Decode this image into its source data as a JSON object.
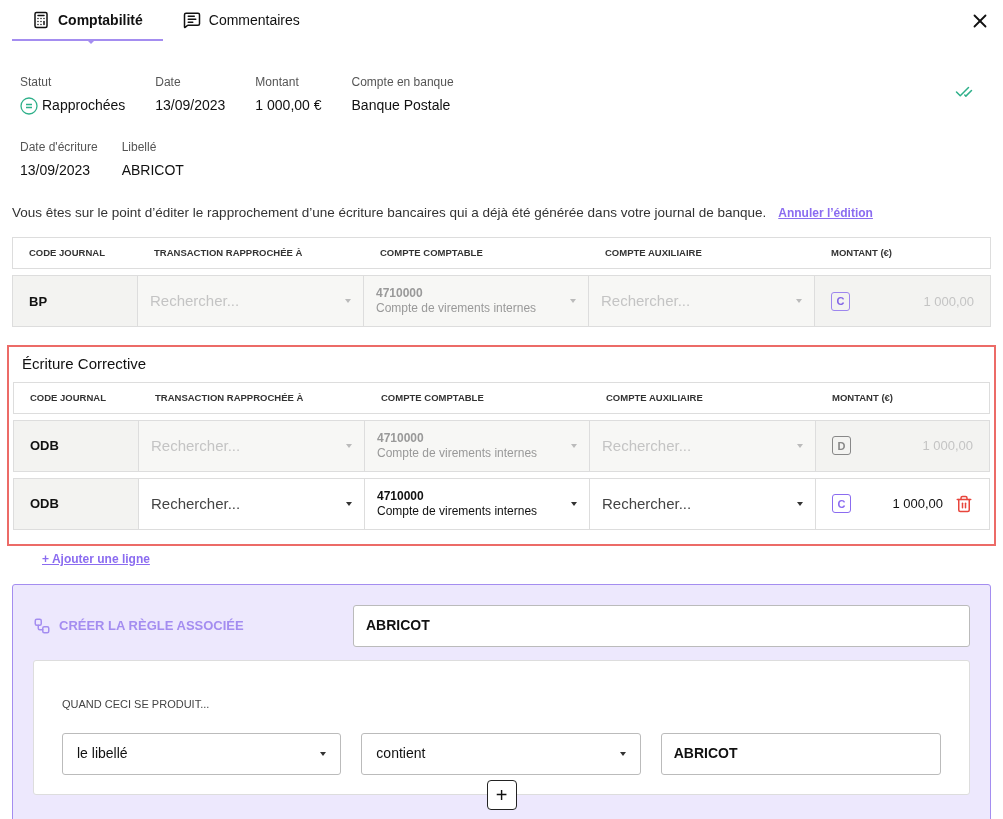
{
  "tabs": [
    {
      "label": "Comptabilité",
      "selected": true
    },
    {
      "label": "Commentaires",
      "selected": false
    }
  ],
  "summary": [
    {
      "label": "Statut",
      "value": "Rapprochées",
      "kind": "status"
    },
    {
      "label": "Date",
      "value": "13/09/2023",
      "kind": "text"
    },
    {
      "label": "Montant",
      "value": "1 000,00 €",
      "kind": "text"
    },
    {
      "label": "Compte en banque",
      "value": "Banque Postale",
      "kind": "text"
    }
  ],
  "summary2": [
    {
      "label": "Date d'écriture",
      "value": "13/09/2023"
    },
    {
      "label": "Libellé",
      "value": "ABRICOT"
    }
  ],
  "notice": {
    "text": "Vous êtes sur le point d’éditer le rapprochement d’une écriture bancaires qui a déjà été générée dans votre journal de banque.",
    "link": "Annuler l’édition"
  },
  "columns": [
    "CODE JOURNAL",
    "TRANSACTION RAPPROCHÉE À",
    "COMPTE COMPTABLE",
    "COMPTE AUXILIAIRE",
    "MONTANT (€)"
  ],
  "bank_rows": [
    {
      "journal": "BP",
      "transaction_placeholder": "Rechercher...",
      "account_number": "4710000",
      "account_name": "Compte de virements internes",
      "auxiliary_placeholder": "Rechercher...",
      "sign": "C",
      "amount": "1 000,00",
      "disabled": true
    }
  ],
  "corrective": {
    "title": "Écriture Corrective",
    "columns": [
      "CODE JOURNAL",
      "TRANSACTION RAPPROCHÉE À",
      "COMPTE COMPTABLE",
      "COMPTE AUXILIAIRE",
      "MONTANT (€)"
    ],
    "rows": [
      {
        "journal": "ODB",
        "transaction_placeholder": "Rechercher...",
        "account_number": "4710000",
        "account_name": "Compte de virements internes",
        "auxiliary_placeholder": "Rechercher...",
        "sign": "D",
        "amount": "1 000,00",
        "disabled": true
      },
      {
        "journal": "ODB",
        "transaction_placeholder": "Rechercher...",
        "account_number": "4710000",
        "account_name": "Compte de virements internes",
        "auxiliary_placeholder": "Rechercher...",
        "sign": "C",
        "amount": "1 000,00",
        "disabled": false
      }
    ]
  },
  "add_line": "+ Ajouter une ligne",
  "rule": {
    "title": "CRÉER LA RÈGLE ASSOCIÉE",
    "name": "ABRICOT",
    "condition_title": "QUAND CECI SE PRODUIT...",
    "field": "le libellé",
    "operator": "contient",
    "value": "ABRICOT",
    "add": "+"
  }
}
